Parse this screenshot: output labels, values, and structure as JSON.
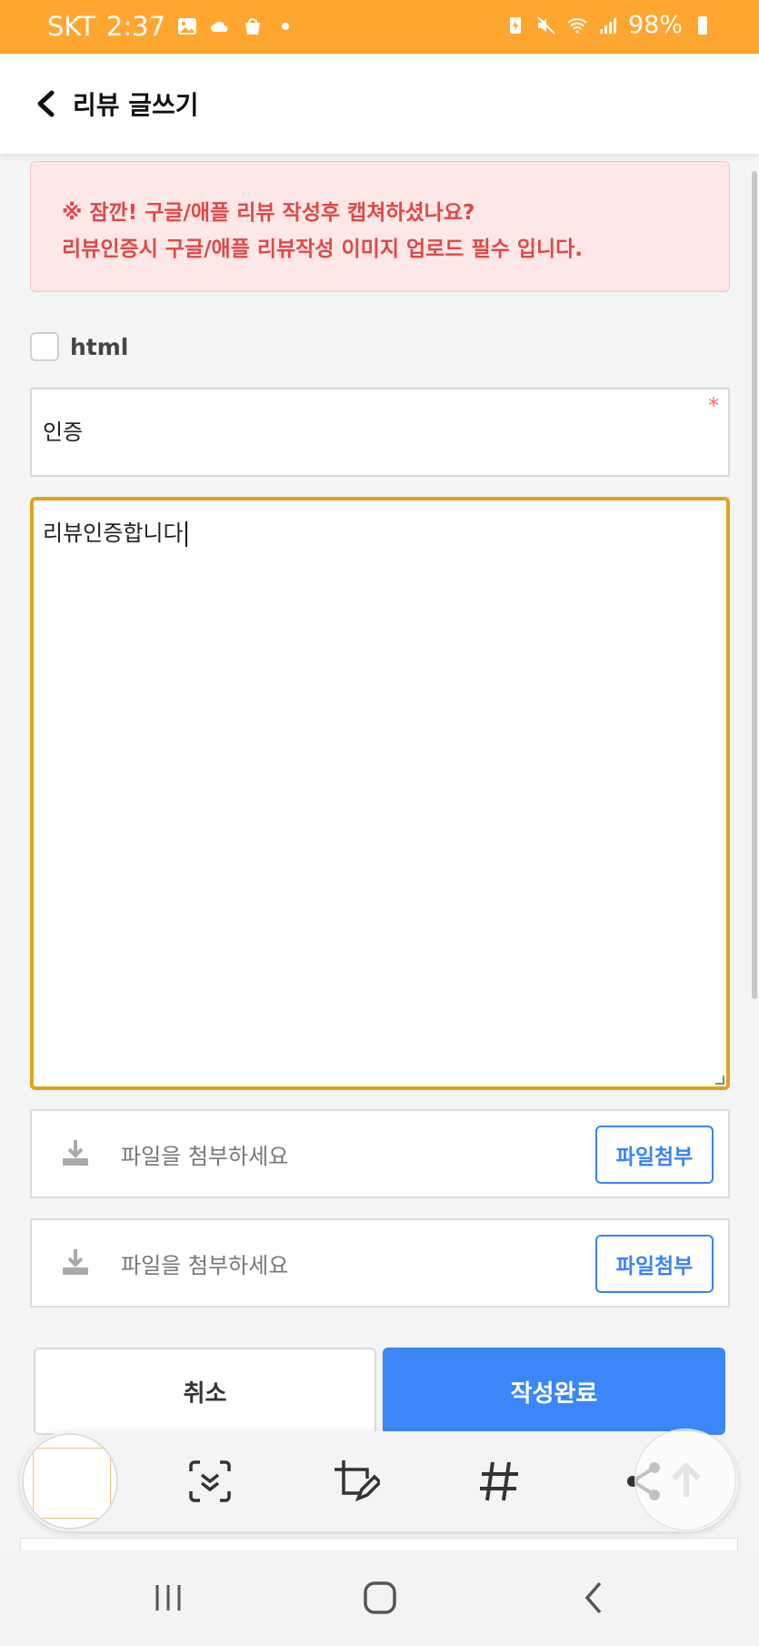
{
  "status_bar": {
    "carrier": "SKT",
    "time": "2:37",
    "battery": "98%"
  },
  "app_bar": {
    "title": "리뷰 글쓰기"
  },
  "notice": {
    "line1": "※ 잠깐! 구글/애플 리뷰 작성후 캡쳐하셨나요?",
    "line2": "리뷰인증시 구글/애플 리뷰작성 이미지 업로드 필수 입니다."
  },
  "html_option": {
    "label": "html",
    "checked": false
  },
  "subject": {
    "value": "인증",
    "required_mark": "*"
  },
  "content": {
    "value": "리뷰인증합니다"
  },
  "attachments": [
    {
      "placeholder": "파일을 첨부하세요",
      "button": "파일첨부"
    },
    {
      "placeholder": "파일을 첨부하세요",
      "button": "파일첨부"
    }
  ],
  "actions": {
    "cancel": "취소",
    "submit": "작성완료"
  },
  "colors": {
    "status_bar": "#ffa630",
    "accent_blue": "#3b87f7",
    "notice_red": "#e04848",
    "focus_border": "#e0a31a"
  }
}
